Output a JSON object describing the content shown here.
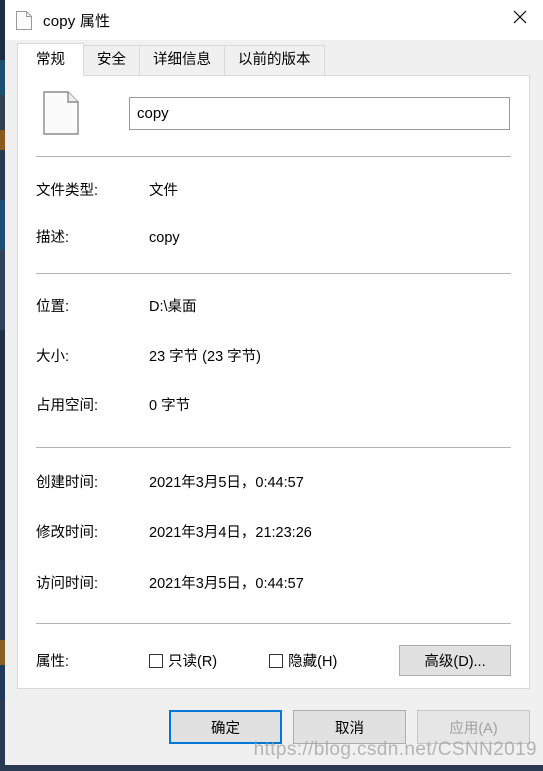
{
  "window": {
    "title": "copy 属性",
    "icon": "file-icon",
    "close_label": "×"
  },
  "tabs": [
    {
      "label": "常规",
      "active": true
    },
    {
      "label": "安全",
      "active": false
    },
    {
      "label": "详细信息",
      "active": false
    },
    {
      "label": "以前的版本",
      "active": false
    }
  ],
  "general": {
    "file_icon": "blank-file-icon",
    "filename_value": "copy",
    "filename_placeholder": "",
    "groups": [
      [
        {
          "label": "文件类型:",
          "value": "文件"
        },
        {
          "label": "描述:",
          "value": "copy"
        }
      ],
      [
        {
          "label": "位置:",
          "value": "D:\\桌面"
        },
        {
          "label": "大小:",
          "value": "23 字节 (23 字节)"
        },
        {
          "label": "占用空间:",
          "value": "0 字节"
        }
      ],
      [
        {
          "label": "创建时间:",
          "value": "2021年3月5日，0:44:57"
        },
        {
          "label": "修改时间:",
          "value": "2021年3月4日，21:23:26"
        },
        {
          "label": "访问时间:",
          "value": "2021年3月5日，0:44:57"
        }
      ]
    ],
    "attributes": {
      "label": "属性:",
      "checkboxes": [
        {
          "label": "只读(R)",
          "checked": false
        },
        {
          "label": "隐藏(H)",
          "checked": false
        }
      ],
      "advanced_button": "高级(D)..."
    }
  },
  "footer": {
    "ok": "确定",
    "cancel": "取消",
    "apply": "应用(A)",
    "apply_disabled": true
  },
  "watermark": "https://blog.csdn.net/CSNN2019",
  "colors": {
    "accent": "#0078d7",
    "dialog_bg": "#f0f0f0",
    "panel_bg": "#ffffff",
    "button_bg": "#e1e1e1",
    "separator": "#b4b4b4",
    "disabled_text": "#a0a0a0"
  }
}
